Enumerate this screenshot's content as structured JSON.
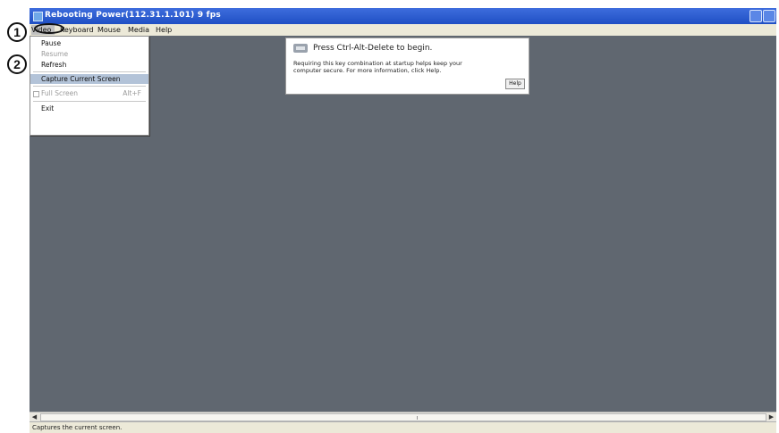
{
  "window": {
    "title": "Rebooting Power(112.31.1.101) 9 fps"
  },
  "menubar": {
    "items": [
      {
        "label": "Video"
      },
      {
        "label": "Keyboard"
      },
      {
        "label": "Mouse"
      },
      {
        "label": "Media"
      },
      {
        "label": "Help"
      }
    ]
  },
  "video_menu": {
    "items": [
      {
        "label": "Pause",
        "state": "enabled"
      },
      {
        "label": "Resume",
        "state": "disabled"
      },
      {
        "label": "Refresh",
        "state": "enabled"
      },
      {
        "label": "Capture Current Screen",
        "state": "highlighted"
      },
      {
        "label": "Full Screen",
        "state": "disabled",
        "shortcut": "Alt+F",
        "checkbox": true
      },
      {
        "label": "Exit",
        "state": "enabled"
      }
    ]
  },
  "notice": {
    "headline": "Press Ctrl-Alt-Delete to begin.",
    "body": "Requiring this key combination at startup helps keep your computer secure. For more information, click Help.",
    "help_label": "Help"
  },
  "statusbar": {
    "text": "Captures the current screen."
  },
  "callouts": [
    {
      "label": "1"
    },
    {
      "label": "2"
    }
  ],
  "colors": {
    "titlebar": "#1f4fc4",
    "desktop": "#606770",
    "menu_highlight": "#b3c3d8"
  }
}
